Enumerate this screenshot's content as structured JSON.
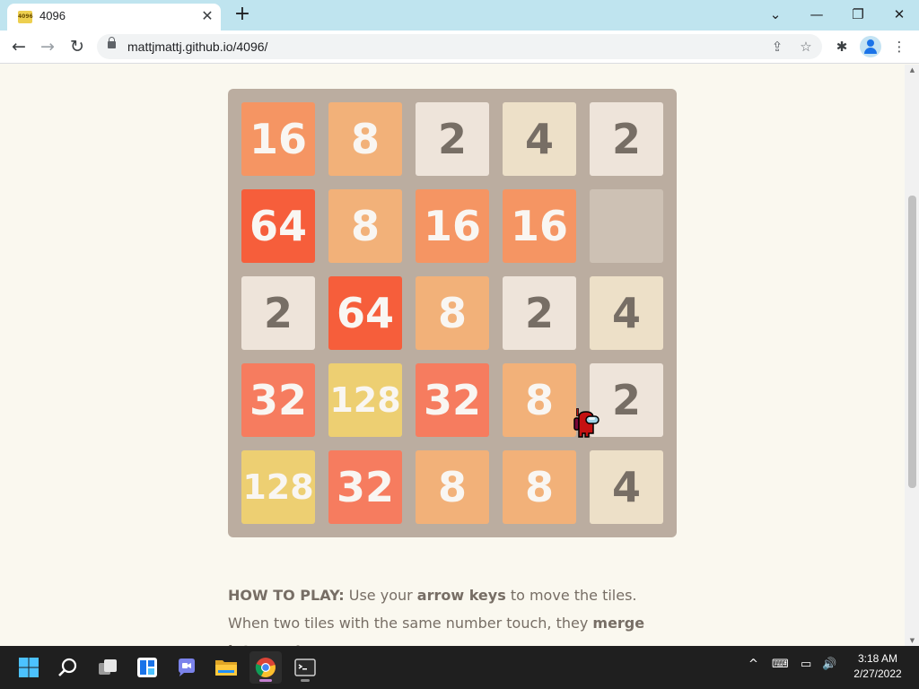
{
  "browser": {
    "tab": {
      "favicon_text": "4096",
      "title": "4096",
      "close": "✕"
    },
    "new_tab": "+",
    "window": {
      "dropdown": "⌄",
      "minimize": "—",
      "restore": "❐",
      "close": "✕"
    },
    "nav": {
      "back": "←",
      "forward": "→",
      "reload": "↻"
    },
    "url": "mattjmattj.github.io/4096/",
    "icons": {
      "share": "⇪",
      "star": "☆",
      "extensions": "✱",
      "menu": "⋮"
    }
  },
  "game": {
    "grid": [
      [
        16,
        8,
        2,
        4,
        2
      ],
      [
        64,
        8,
        16,
        16,
        0
      ],
      [
        2,
        64,
        8,
        2,
        4
      ],
      [
        32,
        128,
        32,
        8,
        2
      ],
      [
        128,
        32,
        8,
        8,
        4
      ]
    ],
    "colors": {
      "board": "#bbada0",
      "empty": "#cdc1b4",
      "2": "#eee4da",
      "4": "#ede0c8",
      "8": "#f2b179",
      "16": "#f59563",
      "32": "#f67c5f",
      "64": "#f65e3b",
      "128": "#edcf72"
    }
  },
  "instructions": {
    "label": "HOW TO PLAY:",
    "text1": " Use your ",
    "bold1": "arrow keys",
    "text2": " to move the tiles. When two tiles with the same number touch, they ",
    "bold2": "merge into one!"
  },
  "taskbar": {
    "apps": [
      "start-icon",
      "search-icon",
      "task-view-icon",
      "widgets-icon",
      "chat-icon",
      "file-explorer-icon",
      "chrome-icon",
      "terminal-icon"
    ],
    "tray": {
      "chevron": "^",
      "keyboard": "⌨",
      "network": "▭",
      "volume": "🔊"
    },
    "time": "3:18 AM",
    "date": "2/27/2022"
  }
}
